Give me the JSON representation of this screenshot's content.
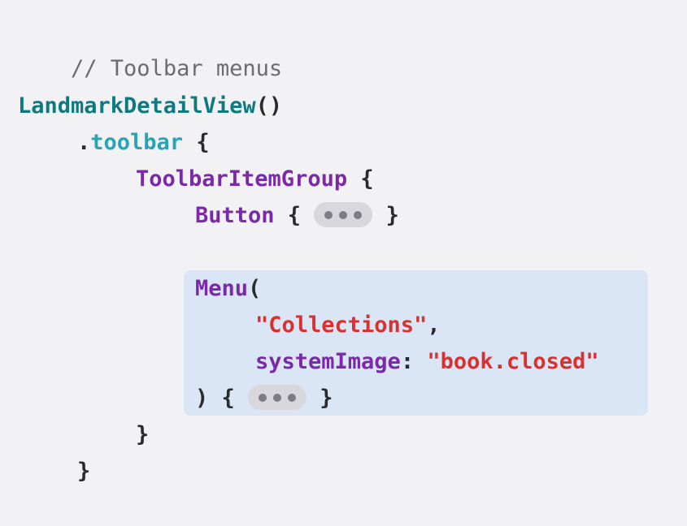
{
  "code": {
    "comment": "// Toolbar menus",
    "view_name": "LandmarkDetailView",
    "view_parens": "()",
    "dot": ".",
    "modifier": "toolbar",
    "open_brace": " {",
    "group_name": "ToolbarItemGroup",
    "button_name": "Button",
    "button_open": " { ",
    "button_close": " }",
    "menu_name": "Menu",
    "menu_open_paren": "(",
    "title_string": "\"Collections\"",
    "comma": ",",
    "param_label": "systemImage",
    "colon": ": ",
    "image_string": "\"book.closed\"",
    "menu_close": ") { ",
    "menu_close_brace": " }",
    "close_brace_group": "}",
    "close_brace_toolbar": "}"
  },
  "colors": {
    "background": "#f2f2f4",
    "highlight": "#dae5f5",
    "type": "#0d7a80",
    "method": "#2aa3b5",
    "keyword": "#7a2aa8",
    "string": "#d93030",
    "comment": "#6b6b70"
  },
  "icons": {
    "collapsed_code": "ellipsis-icon"
  }
}
